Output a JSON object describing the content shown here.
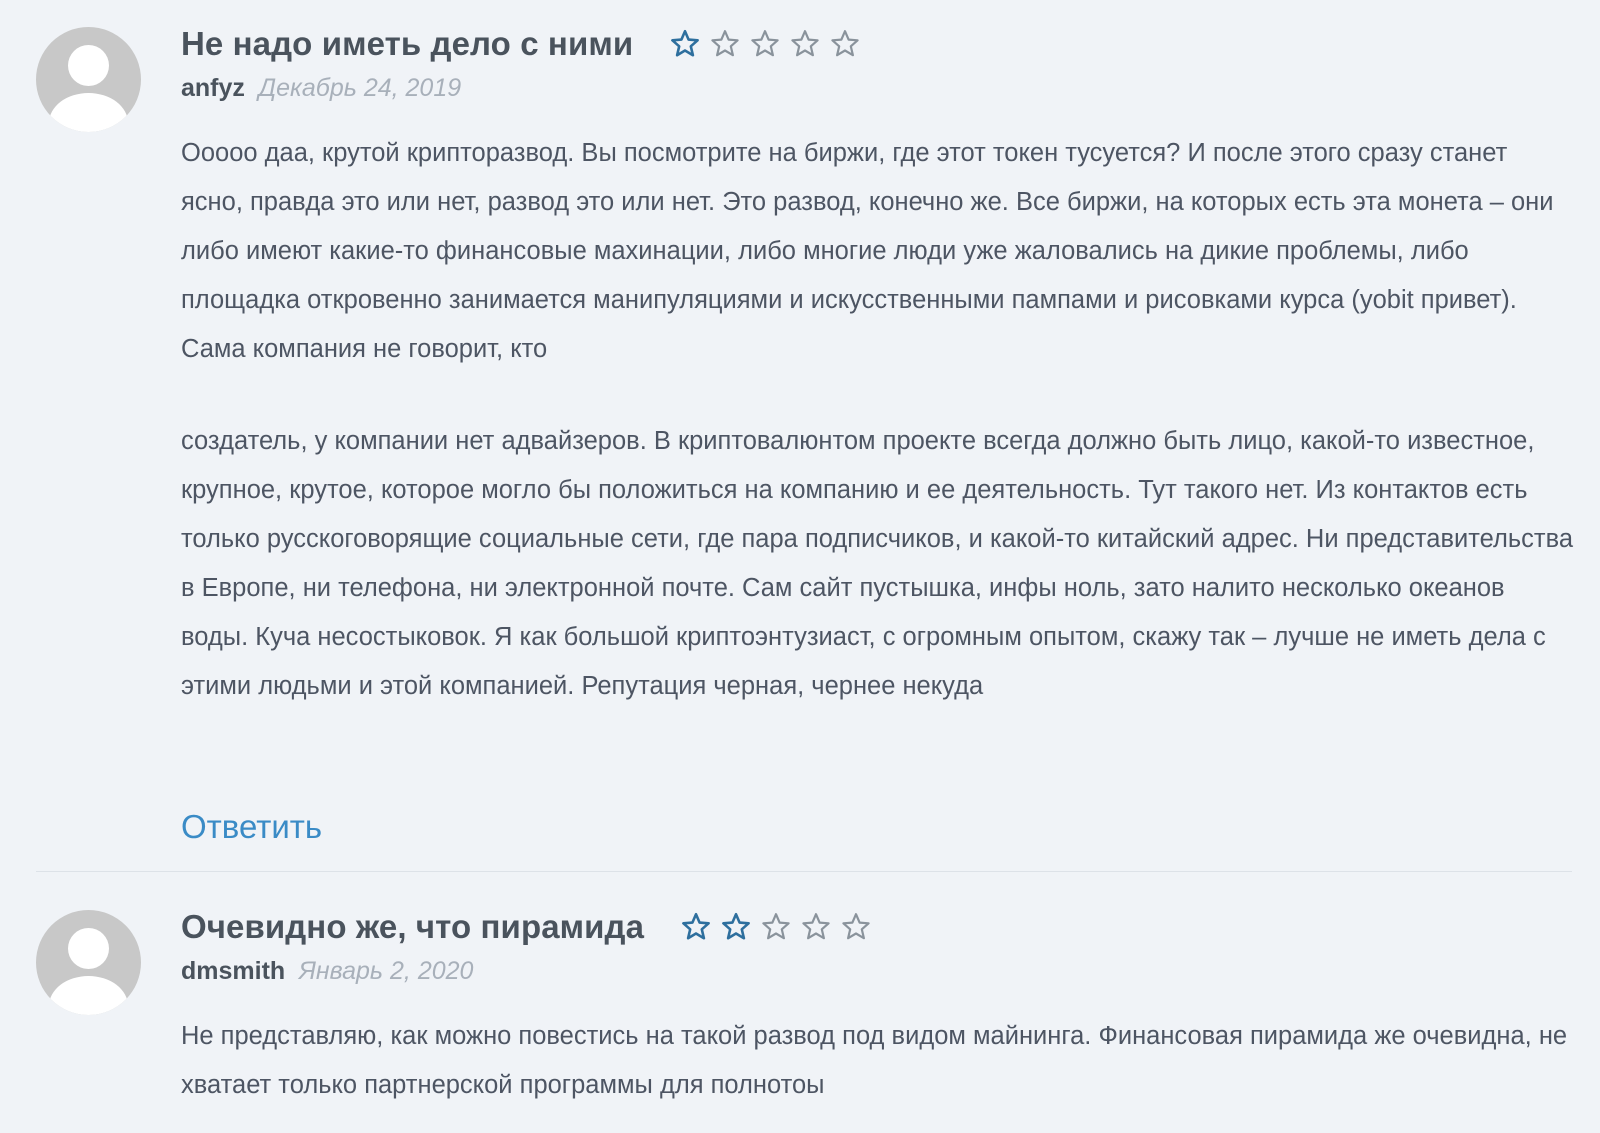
{
  "colors": {
    "background": "#f0f3f7",
    "star_filled": "#2e6f9e",
    "star_empty": "#8a939c",
    "link": "#3a8bc6",
    "date": "#a8b0ba"
  },
  "icons": {
    "avatar": "default-user-avatar-icon",
    "star": "star-outline-icon"
  },
  "reviews": [
    {
      "title": "Не надо иметь дело с ними",
      "rating": 1,
      "rating_max": 5,
      "author": "anfyz",
      "date": "Декабрь 24, 2019",
      "paragraphs": [
        "Ооооо даа, крутой крипторазвод. Вы посмотрите на биржи, где этот токен тусуется? И после этого сразу станет ясно, правда это или нет, развод это или нет. Это развод, конечно же. Все биржи, на которых есть эта монета – они либо имеют какие-то финансовые махинации, либо многие люди уже жаловались на дикие проблемы, либо площадка откровенно занимается манипуляциями и искусственными пампами и рисовками курса (yobit привет). Сама компания не говорит, кто",
        "создатель, у компании нет адвайзеров. В криптовалюнтом проекте всегда должно быть лицо, какой-то известное, крупное, крутое, которое могло бы положиться на компанию и ее деятельность. Тут такого нет. Из контактов есть только русскоговорящие социальные сети, где пара подписчиков, и какой-то китайский адрес. Ни представительства в Европе, ни телефона, ни электронной почте. Сам сайт пустышка, инфы ноль, зато налито несколько океанов воды. Куча несостыковок. Я как большой криптоэнтузиаст, с огромным опытом, скажу так – лучше не иметь дела с этими людьми и этой компанией. Репутация черная, чернее некуда"
      ],
      "reply_label": "Ответить"
    },
    {
      "title": "Очевидно же, что пирамида",
      "rating": 2,
      "rating_max": 5,
      "author": "dmsmith",
      "date": "Январь 2, 2020",
      "paragraphs": [
        "Не представляю, как можно повестись на такой развод под видом майнинга. Финансовая пирамида же очевидна, не хватает только партнерской программы для полнотоы"
      ]
    }
  ]
}
